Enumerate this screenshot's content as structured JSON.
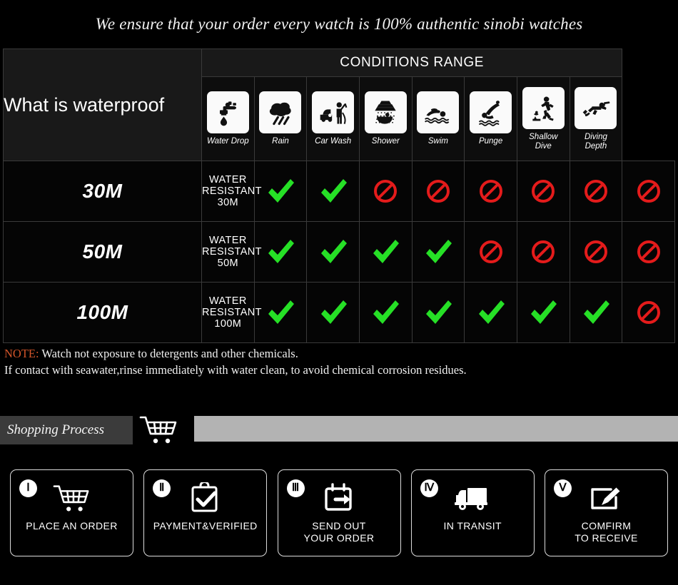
{
  "headline": "We ensure that your order every watch is 100% authentic sinobi watches",
  "table": {
    "left_header": "What is waterproof",
    "conditions_title": "CONDITIONS RANGE",
    "conditions": [
      {
        "label": "Water Drop",
        "icon": "faucet-drop-icon"
      },
      {
        "label": "Rain",
        "icon": "rain-cloud-icon"
      },
      {
        "label": "Car Wash",
        "icon": "car-wash-icon"
      },
      {
        "label": "Shower",
        "icon": "shower-icon"
      },
      {
        "label": "Swim",
        "icon": "swimmer-icon"
      },
      {
        "label": "Punge",
        "icon": "plunge-dive-icon"
      },
      {
        "label": "Shallow\nDive",
        "icon": "shallow-dive-icon"
      },
      {
        "label": "Diving\nDepth",
        "icon": "diving-depth-icon"
      }
    ],
    "rows": [
      {
        "depth": "30M",
        "resistance": "WATER RESISTANT  30M",
        "marks": [
          "check",
          "check",
          "ban",
          "ban",
          "ban",
          "ban",
          "ban",
          "ban"
        ]
      },
      {
        "depth": "50M",
        "resistance": "WATER RESISTANT 50M",
        "marks": [
          "check",
          "check",
          "check",
          "check",
          "ban",
          "ban",
          "ban",
          "ban"
        ]
      },
      {
        "depth": "100M",
        "resistance": "WATER RESISTANT  100M",
        "marks": [
          "check",
          "check",
          "check",
          "check",
          "check",
          "check",
          "check",
          "ban"
        ]
      }
    ]
  },
  "note": {
    "tag": "NOTE:",
    "line1": " Watch not exposure to detergents and other chemicals.",
    "line2": "If contact with seawater,rinse immediately with water clean, to avoid chemical corrosion residues."
  },
  "shopping_process": {
    "title": "Shopping Process",
    "cart_icon": "shopping-cart-icon"
  },
  "steps": [
    {
      "numeral": "Ⅰ",
      "label": "PLACE AN ORDER",
      "icon": "shopping-cart-icon"
    },
    {
      "numeral": "Ⅱ",
      "label": "PAYMENT&VERIFIED",
      "icon": "clipboard-check-icon"
    },
    {
      "numeral": "Ⅲ",
      "label": "SEND OUT\nYOUR ORDER",
      "icon": "calendar-arrow-icon"
    },
    {
      "numeral": "Ⅳ",
      "label": "IN TRANSIT",
      "icon": "delivery-truck-icon"
    },
    {
      "numeral": "Ⅴ",
      "label": "COMFIRM\nTO RECEIVE",
      "icon": "edit-pencil-icon"
    }
  ],
  "colors": {
    "background": "#000000",
    "check_green": "#26e026",
    "ban_red": "#e41b1b",
    "note_accent": "#d2552a",
    "header_cell": "#191919",
    "process_bar_dark": "#3b3b3b",
    "process_bar_light": "#b3b3b3"
  }
}
